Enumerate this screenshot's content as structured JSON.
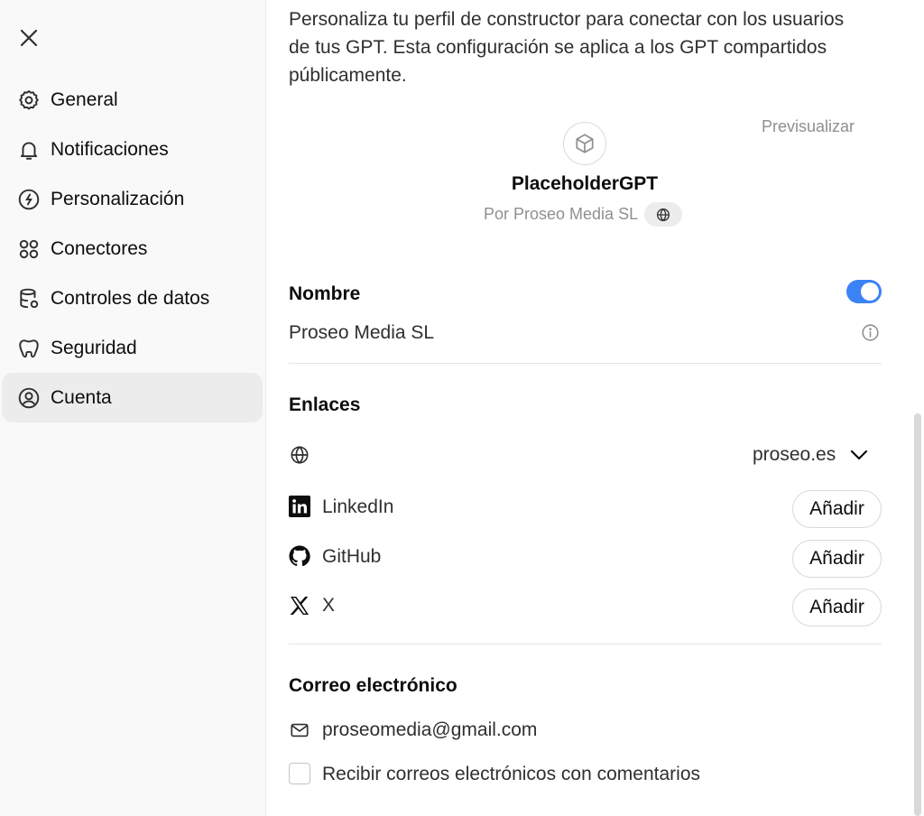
{
  "sidebar": {
    "close_icon": "close-icon",
    "items": [
      {
        "label": "General",
        "icon": "gear-icon"
      },
      {
        "label": "Notificaciones",
        "icon": "bell-icon"
      },
      {
        "label": "Personalización",
        "icon": "personalization-icon"
      },
      {
        "label": "Conectores",
        "icon": "connectors-icon"
      },
      {
        "label": "Controles de datos",
        "icon": "database-icon"
      },
      {
        "label": "Seguridad",
        "icon": "security-icon"
      },
      {
        "label": "Cuenta",
        "icon": "user-circle-icon",
        "active": true
      }
    ]
  },
  "main": {
    "intro": "Personaliza tu perfil de constructor para conectar con los usuarios de tus GPT. Esta configuración se aplica a los GPT compartidos públicamente.",
    "preview": {
      "link_label": "Previsualizar",
      "gpt_name": "PlaceholderGPT",
      "by_line": "Por Proseo Media SL"
    },
    "nombre": {
      "title": "Nombre",
      "value": "Proseo Media SL",
      "toggle_on": true
    },
    "enlaces": {
      "title": "Enlaces",
      "domain": "proseo.es",
      "items": [
        {
          "label": "LinkedIn",
          "button": "Añadir",
          "icon": "linkedin-icon"
        },
        {
          "label": "GitHub",
          "button": "Añadir",
          "icon": "github-icon"
        },
        {
          "label": "X",
          "button": "Añadir",
          "icon": "x-icon"
        }
      ]
    },
    "correo": {
      "title": "Correo electrónico",
      "email": "proseomedia@gmail.com",
      "checkbox_label": "Recibir correos electrónicos con comentarios",
      "checkbox_checked": false
    }
  },
  "colors": {
    "accent": "#3b82f6",
    "sidebar_bg": "#f9f9f9",
    "active_item_bg": "#ececec",
    "muted_text": "#8f8f8f"
  }
}
